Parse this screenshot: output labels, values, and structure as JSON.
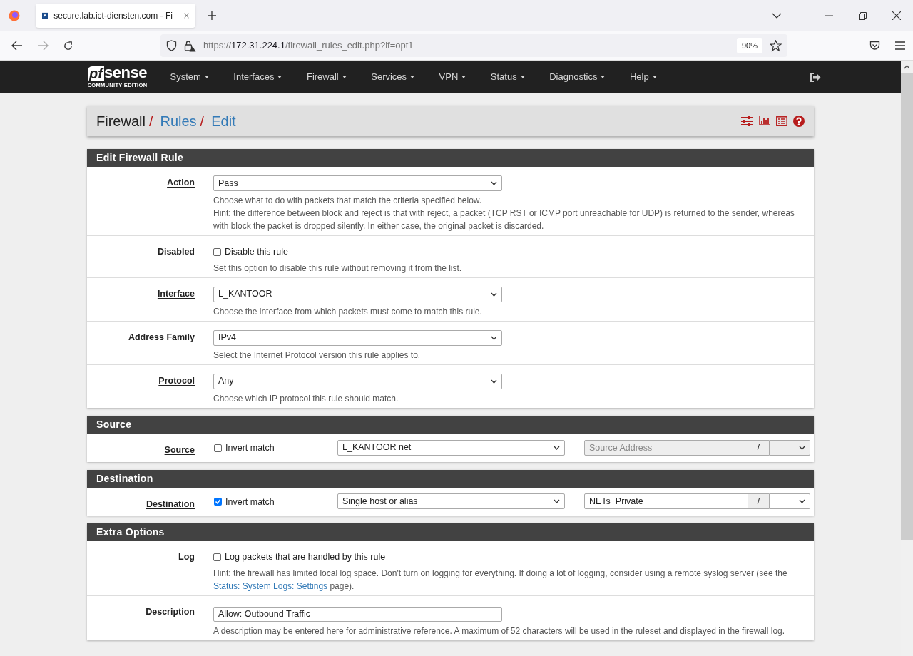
{
  "browser": {
    "tab_title": "secure.lab.ict-diensten.com - Fi",
    "url": {
      "scheme": "https://",
      "host": "172.31.224.1",
      "path": "/firewall_rules_edit.php?if=opt1"
    },
    "zoom": "90%"
  },
  "navbar": {
    "logo": {
      "mark": "pf",
      "word": "sense",
      "edition": "COMMUNITY EDITION"
    },
    "menus": [
      {
        "label": "System"
      },
      {
        "label": "Interfaces"
      },
      {
        "label": "Firewall"
      },
      {
        "label": "Services"
      },
      {
        "label": "VPN"
      },
      {
        "label": "Status"
      },
      {
        "label": "Diagnostics"
      },
      {
        "label": "Help"
      }
    ]
  },
  "breadcrumb": [
    {
      "label": "Firewall",
      "link": false,
      "separator": "/"
    },
    {
      "label": "Rules",
      "link": true,
      "separator": "/"
    },
    {
      "label": "Edit",
      "link": true
    }
  ],
  "sections": [
    {
      "title": "Edit Firewall Rule",
      "rows": [
        {
          "kind": "select",
          "label": "Action",
          "underlined": true,
          "value": "Pass",
          "help": [
            "Choose what to do with packets that match the criteria specified below.",
            "Hint: the difference between block and reject is that with reject, a packet (TCP RST or ICMP port unreachable for UDP) is returned to the sender, whereas with block the packet is dropped silently. In either case, the original packet is discarded."
          ]
        },
        {
          "kind": "checkbox",
          "label": "Disabled",
          "underlined": false,
          "text": "Disable this rule",
          "checked": false,
          "help": [
            "Set this option to disable this rule without removing it from the list."
          ]
        },
        {
          "kind": "select",
          "label": "Interface",
          "underlined": true,
          "value": "L_KANTOOR",
          "help": [
            "Choose the interface from which packets must come to match this rule."
          ]
        },
        {
          "kind": "select",
          "label": "Address Family",
          "underlined": true,
          "value": "IPv4",
          "help": [
            "Select the Internet Protocol version this rule applies to."
          ]
        },
        {
          "kind": "select",
          "label": "Protocol",
          "underlined": true,
          "value": "Any",
          "help": [
            "Choose which IP protocol this rule should match."
          ]
        }
      ]
    },
    {
      "title": "Source",
      "rows": [
        {
          "kind": "address",
          "label": "Source",
          "underlined": true,
          "text": "Invert match",
          "checked": false,
          "type": "L_KANTOOR net",
          "address": {
            "placeholder": "Source Address",
            "disabled": true
          },
          "slash": "/"
        }
      ]
    },
    {
      "title": "Destination",
      "rows": [
        {
          "kind": "address",
          "label": "Destination",
          "underlined": true,
          "text": "Invert match",
          "checked": true,
          "type": "Single host or alias",
          "address": {
            "value": "NETs_Private",
            "disabled": false
          },
          "slash": "/"
        }
      ]
    },
    {
      "title": "Extra Options",
      "rows": [
        {
          "kind": "checkbox",
          "label": "Log",
          "underlined": false,
          "text": "Log packets that are handled by this rule",
          "checked": false,
          "help": [
            [
              {
                "kind": "text",
                "text": "Hint: the firewall has limited local log space. Don't turn on logging for everything. If doing a lot of logging, consider using a remote syslog server (see the "
              },
              {
                "kind": "link",
                "text": "Status: System Logs: Settings"
              },
              {
                "kind": "text",
                "text": " page)."
              }
            ]
          ]
        },
        {
          "kind": "text",
          "label": "Description",
          "underlined": false,
          "value": "Allow: Outbound Traffic",
          "help": [
            "A description may be entered here for administrative reference. A maximum of 52 characters will be used in the ruleset and displayed in the firewall log."
          ]
        }
      ]
    }
  ]
}
